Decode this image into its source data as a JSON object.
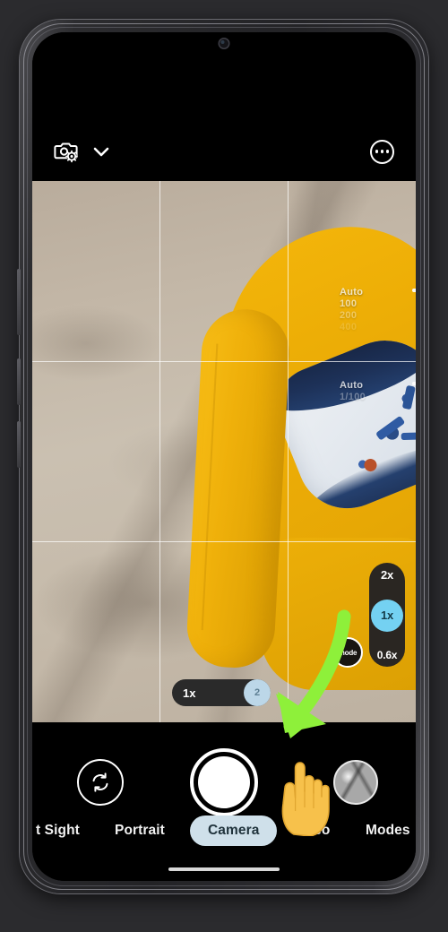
{
  "app": {
    "name": "Camera",
    "platform": "Android"
  },
  "colors": {
    "accent_zoom_active": "#74d1f2",
    "accent_mode_selected": "#cfe0ea",
    "chair_yellow": "#f0b007",
    "annotation_arrow_green": "#8ef03a",
    "annotation_hand_yellow": "#f7c14b",
    "screen_black": "#000000",
    "phone_body": "#2c2c2f",
    "page_background": "#2b2b2e"
  },
  "topbar": {
    "camera_settings_icon": "camera-settings-icon",
    "expand_chevron_icon": "chevron-down-icon",
    "more_options_icon": "more-options-icon"
  },
  "viewfinder": {
    "grid_enabled": true,
    "grid_type": "3x3 rule-of-thirds",
    "scene_description": "Top-down view of a yellow armchair with a blue and white patterned cushion on a beige carpet",
    "exposure_overlays": [
      {
        "label": "Auto",
        "values": [
          "100",
          "200",
          "400"
        ],
        "control": "iso-selector"
      },
      {
        "label": "Auto",
        "values": [
          "1/100"
        ],
        "control": "shutter-speed-selector"
      }
    ],
    "zoom_pill": {
      "options": [
        "2x",
        "1x",
        "0.6x"
      ],
      "selected": "1x"
    },
    "mode_button_label": "mode",
    "slider": {
      "label": "1x",
      "knob_value": "2"
    }
  },
  "controls": {
    "flip_camera_label": "flip-camera",
    "shutter_label": "shutter",
    "gallery_label": "gallery-thumbnail"
  },
  "mode_carousel": {
    "items": [
      {
        "label": "t Sight",
        "selected": false
      },
      {
        "label": "Portrait",
        "selected": false
      },
      {
        "label": "Camera",
        "selected": true
      },
      {
        "label": "Video",
        "selected": false
      },
      {
        "label": "Modes",
        "selected": false
      }
    ]
  },
  "annotations": {
    "arrow_icon": "green-curved-arrow-icon",
    "hand_icon": "pointing-hand-icon",
    "hand_glyph": "☝"
  },
  "navigation": {
    "home_indicator": "gesture-home-indicator"
  }
}
